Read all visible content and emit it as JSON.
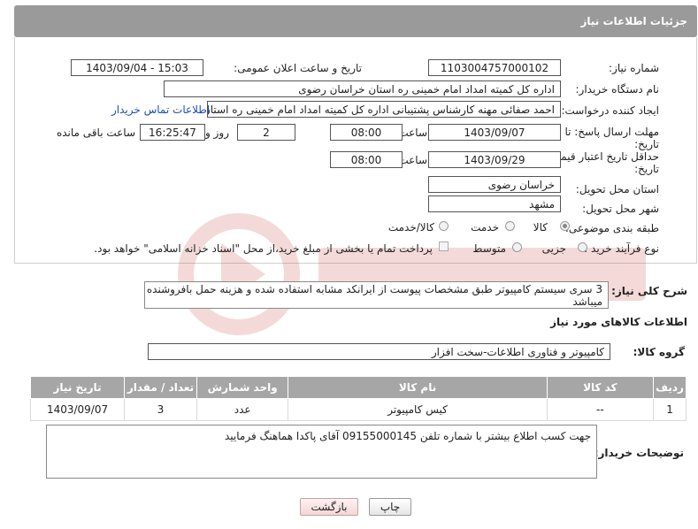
{
  "header": {
    "title": "جزئیات اطلاعات نیاز"
  },
  "form": {
    "need_number_label": "شماره نیاز:",
    "need_number": "1103004757000102",
    "announce_label": "تاریخ و ساعت اعلان عمومی:",
    "announce_value": "1403/09/04 - 15:03",
    "buyer_org_label": "نام دستگاه خریدار:",
    "buyer_org": "اداره کل کمیته امداد امام خمینی  ره  استان خراسان رضوی",
    "requester_label": "ایجاد کننده درخواست:",
    "requester": "احمد صفائی مهنه کارشناس پشتیبانی اداره کل کمیته امداد امام خمینی  ره  استان خراسان رضوی",
    "contact_link": "اطلاعات تماس خریدار",
    "deadline_label_1": "مهلت ارسال پاسخ: تا",
    "deadline_label_2": "تاریخ:",
    "deadline_date": "1403/09/07",
    "time_label": "ساعت",
    "deadline_time": "08:00",
    "days_value": "2",
    "days_label": "روز و",
    "remaining_time": "16:25:47",
    "remaining_label": "ساعت باقی مانده",
    "validity_label_1": "حداقل تاریخ اعتبار قیمت: تا",
    "validity_label_2": "تاریخ:",
    "validity_date": "1403/09/29",
    "validity_time": "08:00",
    "province_label": "استان محل تحویل:",
    "province": "خراسان رضوی",
    "city_label": "شهر محل تحویل:",
    "city": "مشهد",
    "category_label": "طبقه بندی موضوعی:",
    "category_options": [
      "کالا",
      "خدمت",
      "کالا/خدمت"
    ],
    "category_selected": "کالا",
    "process_label": "نوع فرآیند خرید :",
    "process_options": [
      "جزیی",
      "متوسط"
    ],
    "payment_note": "پرداخت تمام یا بخشی از مبلغ خرید،از محل \"اسناد خزانه اسلامی\" خواهد بود."
  },
  "description": {
    "label": "شرح کلی نیاز:",
    "text": "3 سری سیستم کامپیوتر طبق مشخصات پیوست از ایرانکد مشابه استفاده شده و هزینه حمل بافروشنده میباشد"
  },
  "goods": {
    "section_title": "اطلاعات کالاهای مورد نیاز",
    "group_label": "گروه کالا:",
    "group_value": "کامپیوتر و فناوری اطلاعات-سخت افزار",
    "columns": [
      "ردیف",
      "کد کالا",
      "نام کالا",
      "واحد شمارش",
      "تعداد / مقدار",
      "تاریخ نیاز"
    ],
    "rows": [
      {
        "index": "1",
        "code": "--",
        "name": "کیس کامپیوتر",
        "unit": "عدد",
        "qty": "3",
        "date": "1403/09/07"
      }
    ]
  },
  "buyer_notes": {
    "label": "توضیحات خریدار:",
    "text": "جهت کسب اطلاع بیشتر با شماره تلفن 09155000145 آقای پاکدا هماهنگ فرمایید"
  },
  "buttons": {
    "print": "چاپ",
    "back": "بازگشت"
  },
  "colors": {
    "header_bg": "#9a9a9a",
    "link": "#1a4fb5",
    "watermark": "#c0392b"
  }
}
